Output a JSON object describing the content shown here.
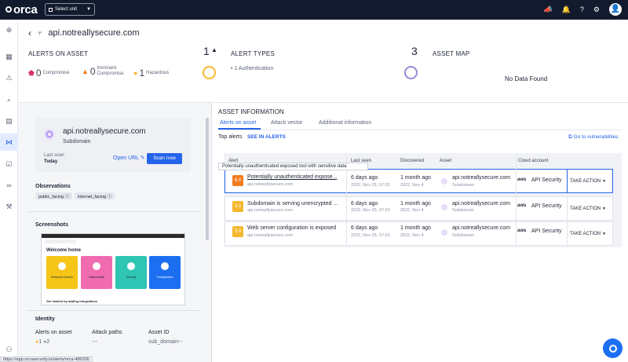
{
  "app": {
    "logo_text": "orca"
  },
  "topbar": {
    "unit_select": "Select unit",
    "icons": [
      "megaphone-icon",
      "bell-icon",
      "help-icon",
      "gear-icon",
      "user-avatar-icon"
    ]
  },
  "nav": {
    "icons": [
      "quick-access-icon",
      "dashboard-icon",
      "alerts-icon",
      "search-icon",
      "inventory-icon",
      "graph-icon",
      "compliance-icon",
      "integrations-icon",
      "settings-icon",
      "users-icon"
    ]
  },
  "header": {
    "title": "api.notreallysecure.com"
  },
  "summary": {
    "alerts_on_asset": {
      "title": "ALERTS ON ASSET",
      "compromise_count": "0",
      "compromise_label": "Compromise",
      "imminent_count": "0",
      "imminent_label_1": "Imminent",
      "imminent_label_2": "Compromise",
      "hazardous_count": "1",
      "hazardous_label": "Hazardous"
    },
    "alert_types": {
      "count": "1",
      "title": "ALERT TYPES",
      "item": "1 Authentication"
    },
    "asset_map": {
      "count": "3",
      "title": "ASSET MAP",
      "empty": "No Data Found"
    }
  },
  "asset_card": {
    "name": "api.notreallysecure.com",
    "type": "Subdomain",
    "last_scan_label": "Last scan",
    "last_scan_value": "Today",
    "open_url": "Open URL",
    "scan_now": "Scan now"
  },
  "observations": {
    "title": "Observations",
    "chips": [
      "public_facing",
      "internet_facing"
    ]
  },
  "screenshots": {
    "title": "Screenshots",
    "thumb_title": "Welcome home",
    "tiles": [
      "Enterprise Search",
      "Observability",
      "Security",
      "Configuration"
    ],
    "thumb_footer": "Get started by adding integrations"
  },
  "identity": {
    "title": "Identity",
    "alerts_label": "Alerts on asset",
    "alerts_val_1": "1",
    "alerts_val_2": "2",
    "attack_label": "Attack paths",
    "attack_val": "---",
    "asset_id_label": "Asset ID",
    "asset_id_val": "sub_domain--"
  },
  "status_url": "https://app.orcasecurity.io/alerts/orca-486206",
  "asset_info": {
    "title": "ASSET INFORMATION",
    "tabs": [
      "Alerts on asset",
      "Attack vector",
      "Additional information"
    ],
    "top_alerts": "Top alerts",
    "see_in_alerts": "SEE IN ALERTS",
    "go_to_vuln": "Go to vulnerabilities",
    "columns": [
      "Alert",
      "Last seen",
      "Discovered",
      "Asset",
      "Cloud account"
    ],
    "tooltip": "Potentially unauthenticated exposed tool with sensitive data",
    "rows": [
      {
        "score": "6.0",
        "title": "Potentially unauthenticated expose...",
        "sub": "api.notreallysecure.com",
        "last_seen": "6 days ago",
        "last_seen_sub": "2022, Nov 25, 07:33",
        "discovered": "1 month ago",
        "discovered_sub": "2022, Nov 4",
        "asset": "api.notreallysecure.com",
        "asset_sub": "Subdomain",
        "cloud": "API Security",
        "action": "TAKE ACTION"
      },
      {
        "score": "3.0",
        "title": "Subdomain is serving unencrypted ...",
        "sub": "api.notreallysecure.com",
        "last_seen": "6 days ago",
        "last_seen_sub": "2022, Nov 25, 07:33",
        "discovered": "1 month ago",
        "discovered_sub": "2022, Nov 4",
        "asset": "api.notreallysecure.com",
        "asset_sub": "Subdomain",
        "cloud": "API Security",
        "action": "TAKE ACTION"
      },
      {
        "score": "3.0",
        "title": "Web server configuration is exposed",
        "sub": "api.notreallysecure.com",
        "last_seen": "6 days ago",
        "last_seen_sub": "2022, Nov 25, 07:33",
        "discovered": "1 month ago",
        "discovered_sub": "2022, Nov 4",
        "asset": "api.notreallysecure.com",
        "asset_sub": "Subdomain",
        "cloud": "API Security",
        "action": "TAKE ACTION"
      }
    ]
  },
  "colors": {
    "accent": "#2563eb",
    "topbar": "#121a2d",
    "score_high": "#f07c1e",
    "score_low": "#f5b82e"
  }
}
